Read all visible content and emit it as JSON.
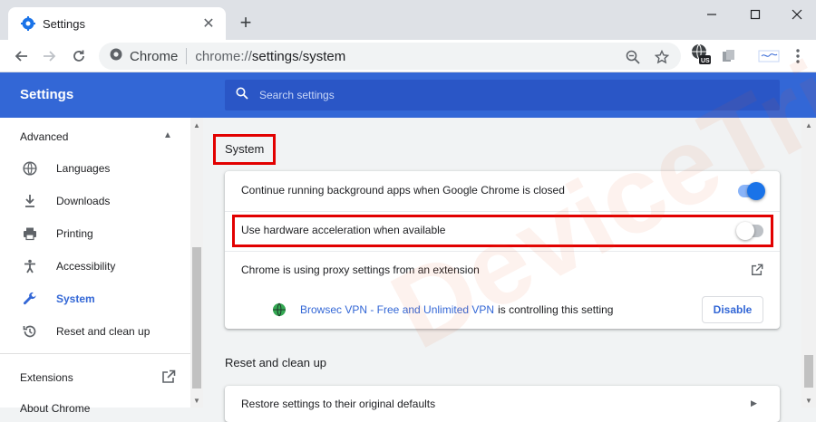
{
  "tab": {
    "title": "Settings",
    "close": "✕",
    "new_tab": "+"
  },
  "window": {
    "minimize": "—",
    "maximize": "☐",
    "close": "✕"
  },
  "omnibox": {
    "chip": "Chrome",
    "url_scheme": "chrome://",
    "url_setting": "settings",
    "url_slash": "/",
    "url_system": "system",
    "ext_badge": "US"
  },
  "header": {
    "title": "Settings",
    "search_placeholder": "Search settings"
  },
  "sidebar": {
    "section": "Advanced",
    "items": [
      {
        "label": "Languages",
        "icon": "globe-icon"
      },
      {
        "label": "Downloads",
        "icon": "download-icon"
      },
      {
        "label": "Printing",
        "icon": "printer-icon"
      },
      {
        "label": "Accessibility",
        "icon": "accessibility-icon"
      },
      {
        "label": "System",
        "icon": "wrench-icon",
        "active": true
      },
      {
        "label": "Reset and clean up",
        "icon": "history-icon"
      }
    ],
    "extensions": "Extensions",
    "about": "About Chrome"
  },
  "system": {
    "title": "System",
    "rows": {
      "background": {
        "label": "Continue running background apps when Google Chrome is closed",
        "enabled": true
      },
      "hardware": {
        "label": "Use hardware acceleration when available",
        "enabled": false
      },
      "proxy": {
        "label": "Chrome is using proxy settings from an extension"
      }
    },
    "controlling": {
      "extension": "Browsec VPN - Free and Unlimited VPN",
      "suffix": "is controlling this setting",
      "button": "Disable"
    }
  },
  "reset": {
    "title": "Reset and clean up",
    "restore": "Restore settings to their original defaults"
  },
  "watermark": "DeviceTricks",
  "colors": {
    "accent": "#3367d6",
    "highlight": "#e20000",
    "toggle_on": "#1a73e8",
    "toggle_track_on": "#8ab4f8",
    "toggle_off": "#ffffff",
    "toggle_track_off": "#bdc1c6"
  }
}
